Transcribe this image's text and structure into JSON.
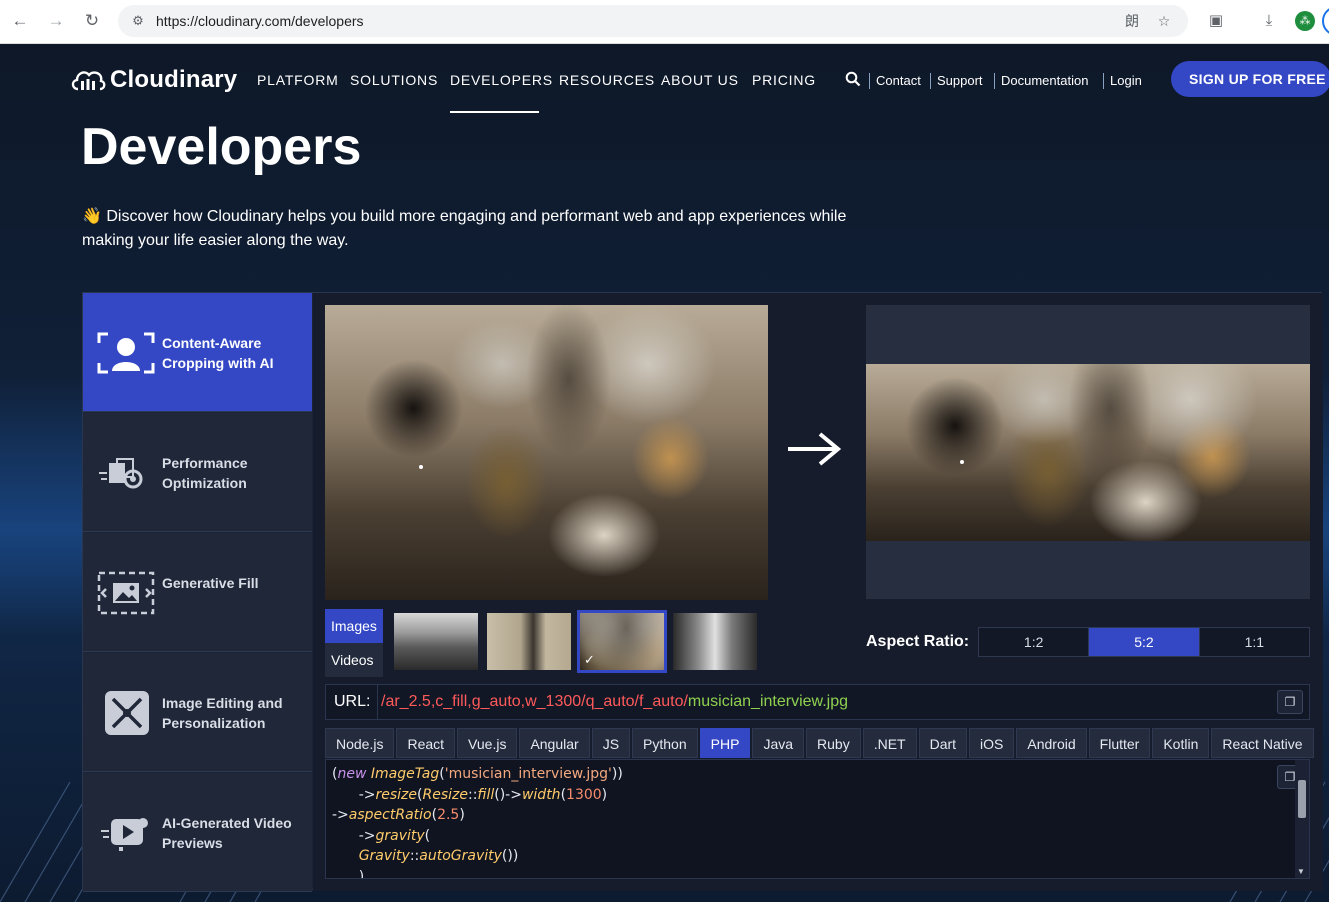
{
  "browser": {
    "url": "https://cloudinary.com/developers",
    "profile_initial": "⁂"
  },
  "header": {
    "logo_text": "Cloudinary",
    "nav": [
      "PLATFORM",
      "SOLUTIONS",
      "DEVELOPERS",
      "RESOURCES",
      "ABOUT US",
      "PRICING"
    ],
    "active_nav": "DEVELOPERS",
    "links": [
      "Contact",
      "Support",
      "Documentation",
      "Login"
    ],
    "cta": "SIGN UP FOR FREE"
  },
  "hero": {
    "title": "Developers",
    "emoji": "👋",
    "subtitle": "Discover how Cloudinary helps you build more engaging and performant web and app experiences while making your life easier along the way."
  },
  "sidebar": {
    "items": [
      {
        "label": "Content-Aware Cropping with AI",
        "icon": "face-crop-icon",
        "active": true
      },
      {
        "label": "Performance Optimization",
        "icon": "speed-media-icon",
        "active": false
      },
      {
        "label": "Generative Fill",
        "icon": "generative-fill-icon",
        "active": false
      },
      {
        "label": "Image Editing and Personalization",
        "icon": "tools-icon",
        "active": false
      },
      {
        "label": "AI-Generated Video Previews",
        "icon": "video-preview-icon",
        "active": false
      }
    ]
  },
  "media_toggle": {
    "images": "Images",
    "videos": "Videos",
    "selected": "Images"
  },
  "thumbnails": [
    {
      "name": "mountain-thumb",
      "selected": false
    },
    {
      "name": "couple-thumb",
      "selected": false
    },
    {
      "name": "interview-thumb",
      "selected": true
    },
    {
      "name": "hallway-thumb",
      "selected": false
    }
  ],
  "aspect_ratio": {
    "label": "Aspect Ratio:",
    "options": [
      "1:2",
      "5:2",
      "1:1"
    ],
    "selected": "5:2"
  },
  "url_bar": {
    "label": "URL:",
    "slash": "/",
    "transformation": "ar_2.5,c_fill,g_auto,w_1300/q_auto/f_auto/",
    "filename": "musician_interview.jpg"
  },
  "languages": {
    "tabs": [
      "Node.js",
      "React",
      "Vue.js",
      "Angular",
      "JS",
      "Python",
      "PHP",
      "Java",
      "Ruby",
      ".NET",
      "Dart",
      "iOS",
      "Android",
      "Flutter",
      "Kotlin",
      "React Native"
    ],
    "selected": "PHP"
  },
  "code": {
    "line1_open": "(",
    "line1_new": "new",
    "line1_class": "ImageTag",
    "line1_arg": "'musician_interview.jpg'",
    "line1_close": "))",
    "line2_pre": "->",
    "line2_fn": "resize",
    "line2_mid1": "(",
    "line2_cls": "Resize",
    "line2_sep": "::",
    "line2_fill": "fill",
    "line2_arrow": "()->",
    "line2_width": "width",
    "line2_paren": "(",
    "line2_num": "1300",
    "line2_end": ")",
    "line3_pre": "->",
    "line3_fn": "aspectRatio",
    "line3_paren": "(",
    "line3_num": "2.5",
    "line3_end": ")",
    "line4_pre": "->",
    "line4_fn": "gravity",
    "line4_end": "(",
    "line5_cls": "Gravity",
    "line5_sep": "::",
    "line5_fn": "autoGravity",
    "line5_end": "())",
    "line6": ")"
  },
  "colors": {
    "accent": "#3448c5",
    "transformation": "#ff5a5a",
    "filename": "#8fd14f"
  }
}
